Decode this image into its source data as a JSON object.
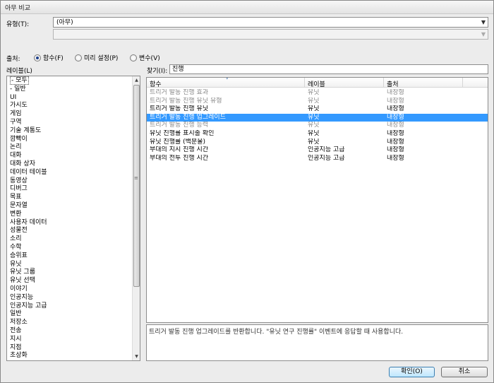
{
  "window": {
    "title": "아무 비교"
  },
  "type": {
    "label": "유형(T):",
    "value": "(아무)",
    "sub_value": ""
  },
  "source": {
    "label": "출처:",
    "options": [
      {
        "label": "함수(F)",
        "checked": true
      },
      {
        "label": "미리 설정(P)",
        "checked": false
      },
      {
        "label": "변수(V)",
        "checked": false
      }
    ]
  },
  "labels_panel": {
    "title": "레이블(L)",
    "items": [
      "- 모두",
      "- 일반",
      "UI",
      "가시도",
      "게임",
      "구역",
      "기술 계통도",
      "깜빡이",
      "논리",
      "대화",
      "대화 상자",
      "데이터 테이블",
      "동영상",
      "디버그",
      "목표",
      "문자열",
      "변환",
      "사용자 데이터",
      "성물전",
      "소리",
      "수학",
      "승위표",
      "유닛",
      "유닛 그룹",
      "유닛 선택",
      "이야기",
      "인공지능",
      "인공지능 고급",
      "일반",
      "저장소",
      "전송",
      "지시",
      "지점",
      "초상화"
    ],
    "selected_index": 0
  },
  "search": {
    "label": "찾기(I):",
    "value": "진행"
  },
  "results": {
    "columns": [
      "함수",
      "레이블",
      "출처"
    ],
    "rows": [
      {
        "name": "트리거 발동 진행 효과",
        "label": "유닛",
        "source": "내장형",
        "style": "gray"
      },
      {
        "name": "트리거 발동 진행 유닛 유형",
        "label": "유닛",
        "source": "내장형",
        "style": "gray"
      },
      {
        "name": "트리거 발동 진행 유닛",
        "label": "유닛",
        "source": "내장형",
        "style": "bold"
      },
      {
        "name": "트리거 발동 진행 업그레이드",
        "label": "유닛",
        "source": "내장형",
        "style": "sel"
      },
      {
        "name": "트리거 발동 진행 능력",
        "label": "유닛",
        "source": "내장형",
        "style": "gray"
      },
      {
        "name": "유닛 진행률 표시줄 확인",
        "label": "유닛",
        "source": "내장형",
        "style": "bold"
      },
      {
        "name": "유닛 진행률 (백분율)",
        "label": "유닛",
        "source": "내장형",
        "style": "bold"
      },
      {
        "name": "부대의 지시 진행 시간",
        "label": "인공지능 고급",
        "source": "내장형",
        "style": "bold"
      },
      {
        "name": "부대의 전투 진행 시간",
        "label": "인공지능 고급",
        "source": "내장형",
        "style": "bold"
      }
    ]
  },
  "description": "트리거 발동 진행 업그레이드를 반환합니다. \"유닛 연구 진행률\" 이벤트에 응답할 때 사용합니다.",
  "buttons": {
    "ok": "확인(O)",
    "cancel": "취소"
  },
  "colors": {
    "selection": "#3399ff",
    "muted_text": "#8a8a8a"
  }
}
